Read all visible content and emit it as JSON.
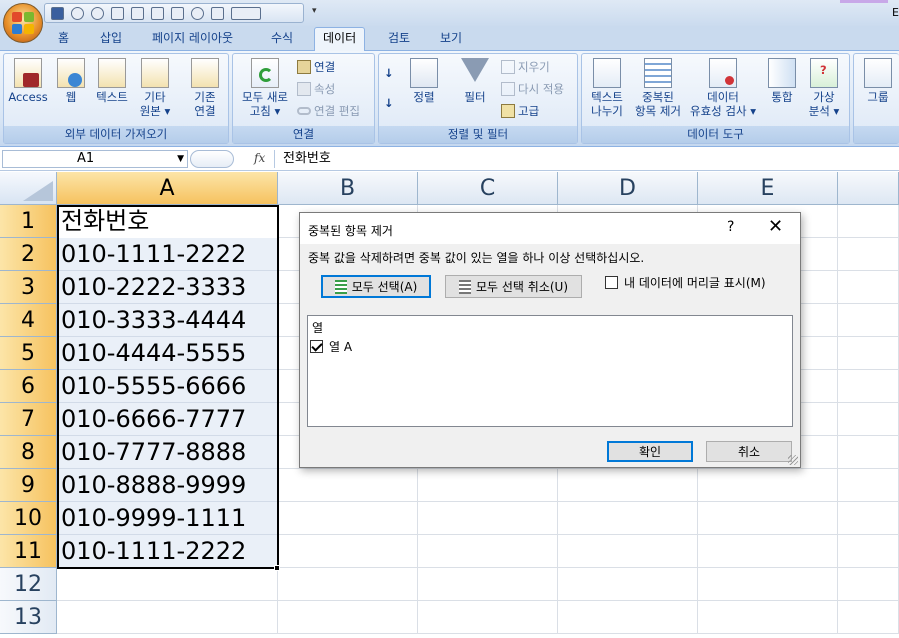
{
  "qat": {
    "caret": "▾",
    "right_char": "E"
  },
  "tabs": [
    "홈",
    "삽입",
    "페이지 레이아웃",
    "수식",
    "데이터",
    "검토",
    "보기"
  ],
  "active_tab": "데이터",
  "ribbon": {
    "groups": {
      "external": "외부 데이터 가져오기",
      "connections": "연결",
      "sort_filter": "정렬 및 필터",
      "tools": "데이터 도구"
    },
    "external": {
      "access": "Access",
      "web": "웹",
      "text": "텍스트",
      "other1": "기타",
      "other2": "원본 ▾",
      "existing1": "기존",
      "existing2": "연결"
    },
    "connections": {
      "refresh1": "모두 새로",
      "refresh2": "고침 ▾",
      "conn": "연결",
      "props": "속성",
      "edit_links": "연결 편집"
    },
    "sort_filter": {
      "sort": "정렬",
      "filter": "필터",
      "clear": "지우기",
      "reapply": "다시 적용",
      "advanced": "고급"
    },
    "tools": {
      "text_cols1": "텍스트",
      "text_cols2": "나누기",
      "dedup1": "중복된",
      "dedup2": "항목 제거",
      "valid1": "데이터",
      "valid2": "유효성 검사 ▾",
      "consolidate": "통합",
      "whatif1": "가상",
      "whatif2": "분석 ▾",
      "group": "그룹"
    }
  },
  "formula_bar": {
    "name_box": "A1",
    "fx": "fx",
    "content": "전화번호"
  },
  "grid": {
    "columns": [
      "A",
      "B",
      "C",
      "D",
      "E"
    ],
    "rows": [
      "1",
      "2",
      "3",
      "4",
      "5",
      "6",
      "7",
      "8",
      "9",
      "10",
      "11",
      "12",
      "13"
    ],
    "cells_a": [
      "전화번호",
      "010-1111-2222",
      "010-2222-3333",
      "010-3333-4444",
      "010-4444-5555",
      "010-5555-6666",
      "010-6666-7777",
      "010-7777-8888",
      "010-8888-9999",
      "010-9999-1111",
      "010-1111-2222"
    ]
  },
  "dialog": {
    "title": "중복된 항목 제거",
    "help": "?",
    "close": "✕",
    "message": "중복 값을 삭제하려면 중복 값이 있는 열을 하나 이상 선택하십시오.",
    "select_all": "모두 선택(A)",
    "unselect_all": "모두 선택 취소(U)",
    "header_checkbox": "내 데이터에 머리글 표시(M)",
    "header_checked": false,
    "list_header": "열",
    "columns": [
      {
        "label": "열 A",
        "checked": true
      }
    ],
    "ok": "확인",
    "cancel": "취소"
  }
}
